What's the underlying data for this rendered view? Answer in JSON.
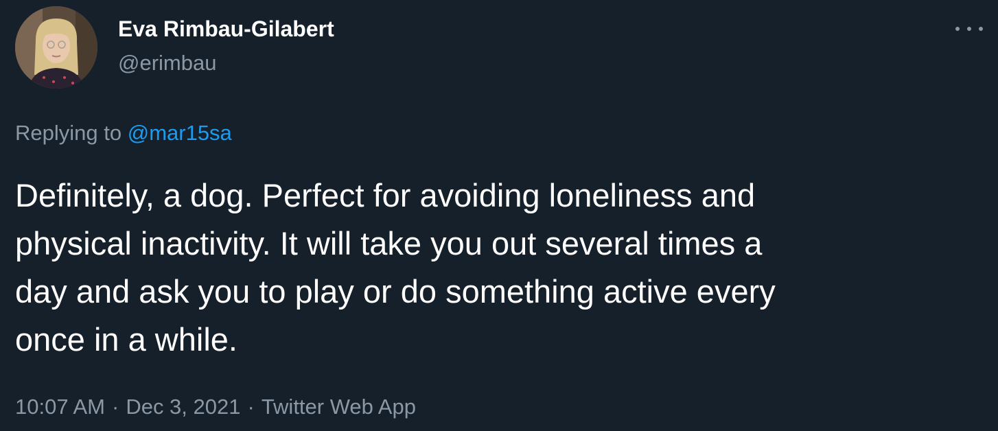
{
  "author": {
    "display_name": "Eva Rimbau-Gilabert",
    "handle": "@erimbau",
    "avatar_icon": "user-avatar-photo"
  },
  "menu_icon": "more-horizontal-icon",
  "reply": {
    "prefix": "Replying to",
    "mention": "@mar15sa"
  },
  "tweet": {
    "lines": [
      "Definitely, a dog. Perfect for avoiding loneliness and",
      "physical inactivity. It will take you out several times a",
      "day and ask you to play or do something active every",
      "once in a while."
    ]
  },
  "meta": {
    "time": "10:07 AM",
    "separator": "·",
    "date": "Dec 3, 2021",
    "source": "Twitter Web App"
  },
  "colors": {
    "background": "#15202b",
    "text_primary": "#ffffff",
    "text_secondary": "#8b98a5",
    "link": "#1d9bf0"
  }
}
